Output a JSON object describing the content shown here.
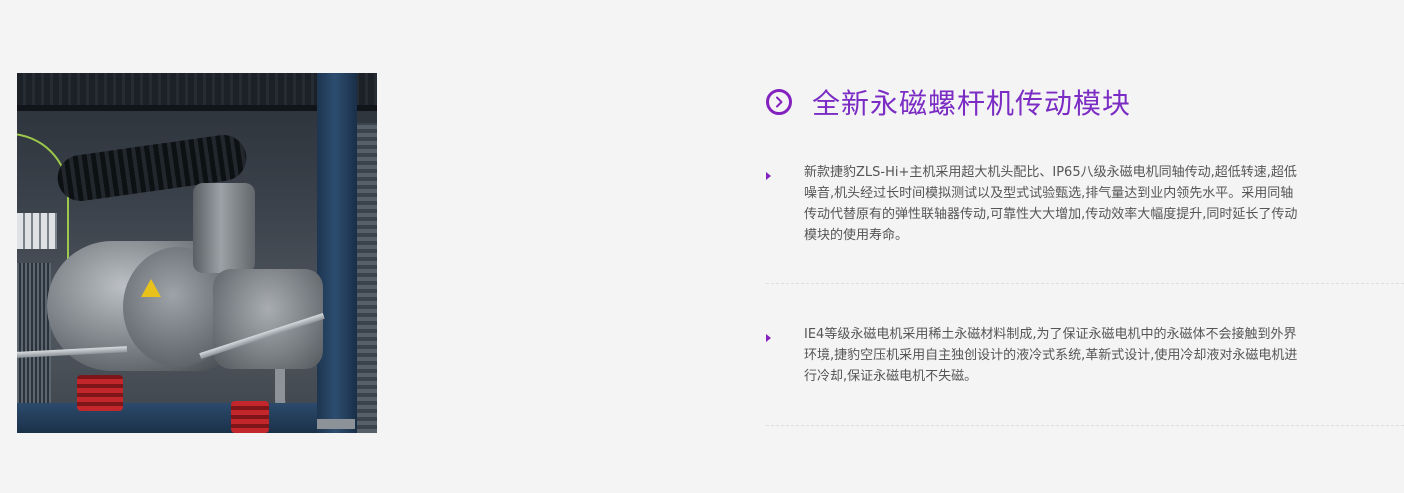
{
  "product_image": {
    "alt": "永磁螺杆空压机内部结构"
  },
  "section": {
    "title": "全新永磁螺杆机传动模块",
    "icon": "chevron-right-circle-icon",
    "accent_color": "#8322bf"
  },
  "features": [
    {
      "text": "新款捷豹ZLS-Hi+主机采用超大机头配比、IP65八级永磁电机同轴传动,超低转速,超低\n噪音,机头经过长时间模拟测试以及型式试验甄选,排气量达到业内领先水平。采用同轴\n传动代替原有的弹性联轴器传动,可靠性大大增加,传动效率大幅度提升,同时延长了传动\n模块的使用寿命。"
    },
    {
      "text": "IE4等级永磁电机采用稀土永磁材料制成,为了保证永磁电机中的永磁体不会接触到外界\n环境,捷豹空压机采用自主独创设计的液冷式系统,革新式设计,使用冷却液对永磁电机进\n行冷却,保证永磁电机不失磁。"
    }
  ]
}
